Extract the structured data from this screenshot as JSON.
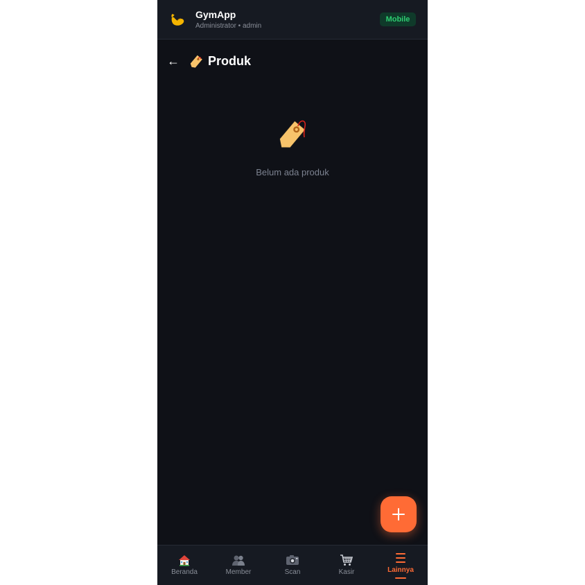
{
  "app": {
    "name": "GymApp",
    "subtitle": "Administrator • admin",
    "mode_badge": "Mobile",
    "logo_icon": "flexed-biceps-icon"
  },
  "page": {
    "back_label": "←",
    "title": "Produk",
    "title_icon": "price-tag-icon"
  },
  "empty_state": {
    "icon": "price-tag-icon",
    "message": "Belum ada produk"
  },
  "fab": {
    "icon": "plus-icon"
  },
  "nav": {
    "items": [
      {
        "label": "Beranda",
        "icon": "house-icon"
      },
      {
        "label": "Member",
        "icon": "people-icon"
      },
      {
        "label": "Scan",
        "icon": "camera-icon"
      },
      {
        "label": "Kasir",
        "icon": "shopping-cart-icon"
      },
      {
        "label": "Lainnya",
        "icon": "menu-icon",
        "active": true
      }
    ]
  },
  "colors": {
    "accent": "#ff6b35",
    "background": "#0f1117",
    "surface": "#161a22",
    "badge_text": "#2ecc71",
    "badge_bg": "#0f3a2a"
  }
}
